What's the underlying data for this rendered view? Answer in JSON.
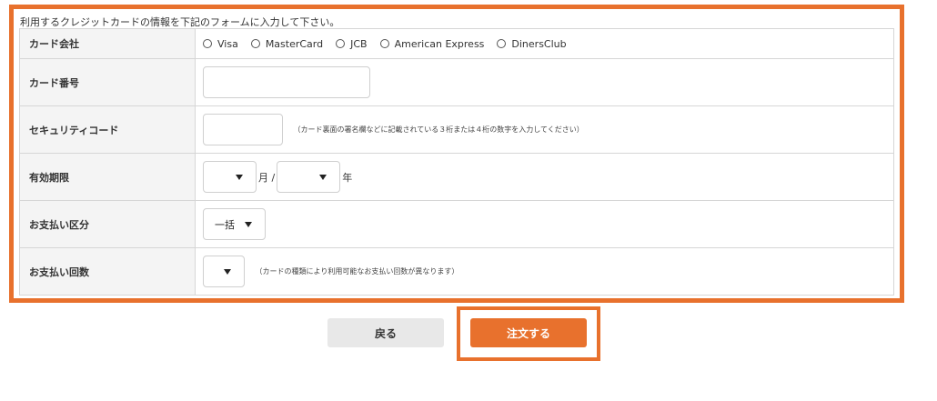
{
  "intro_text": "利用するクレジットカードの情報を下記のフォームに入力して下さい。",
  "rows": {
    "card_company": {
      "label": "カード会社",
      "options": [
        "Visa",
        "MasterCard",
        "JCB",
        "American Express",
        "DinersClub"
      ]
    },
    "card_number": {
      "label": "カード番号",
      "value": ""
    },
    "security_code": {
      "label": "セキュリティコード",
      "value": "",
      "note": "（カード裏面の署名欄などに記載されている３桁または４桁の数字を入力してください）"
    },
    "expiry": {
      "label": "有効期限",
      "month_value": "",
      "month_suffix": "月 /",
      "year_value": "",
      "year_suffix": "年"
    },
    "payment_type": {
      "label": "お支払い区分",
      "selected": "一括"
    },
    "installments": {
      "label": "お支払い回数",
      "selected": "",
      "note": "（カードの種類により利用可能なお支払い回数が異なります）"
    }
  },
  "buttons": {
    "back_label": "戻る",
    "order_label": "注文する"
  },
  "colors": {
    "accent": "#e8712d",
    "label_bg": "#f4f4f4",
    "border": "#d6d6d6",
    "back_bg": "#e8e8e8"
  },
  "icons": {
    "radio": "radio-unchecked-icon",
    "dropdown": "caret-down-icon"
  }
}
